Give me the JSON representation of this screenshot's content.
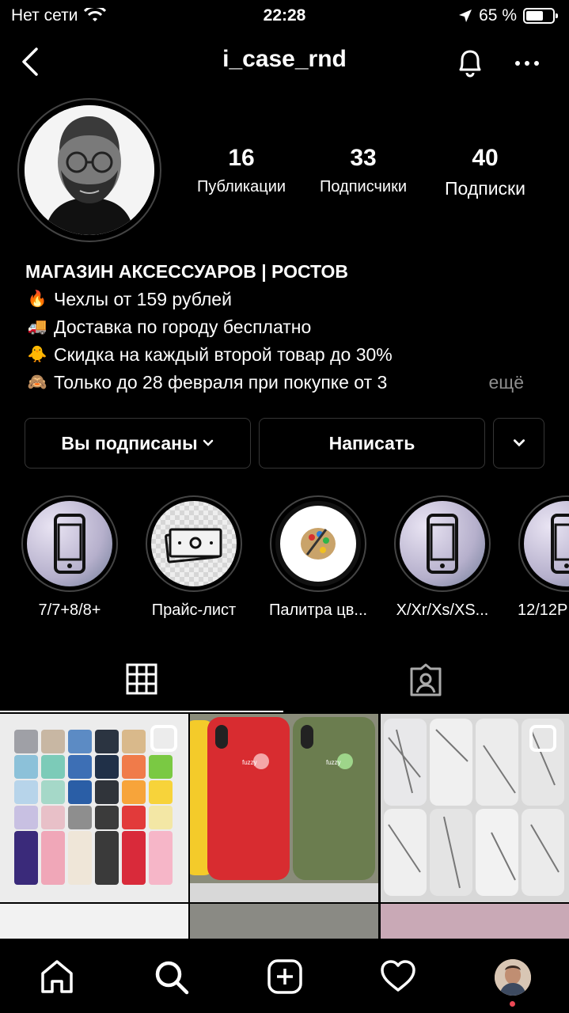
{
  "status_bar": {
    "carrier": "Нет сети",
    "time": "22:28",
    "battery": "65 %",
    "battery_level": 0.65
  },
  "header": {
    "username": "i_case_rnd"
  },
  "stats": [
    {
      "value": "16",
      "label": "Публикации"
    },
    {
      "value": "33",
      "label": "Подписчики"
    },
    {
      "value": "40",
      "label": "Подписки"
    }
  ],
  "bio": {
    "name": "МАГАЗИН АКСЕССУАРОВ | РОСТОВ",
    "lines": [
      {
        "emoji": "🔥",
        "text": "Чехлы от 159 рублей"
      },
      {
        "emoji": "🚚",
        "text": "Доставка по городу бесплатно"
      },
      {
        "emoji": "🐥",
        "text": "Скидка на каждый второй товар до 30%"
      },
      {
        "emoji": "🙈",
        "text": "Только до 28 февраля при покупке от 3"
      }
    ],
    "more": "ещё"
  },
  "buttons": {
    "following": "Вы подписаны",
    "message": "Написать"
  },
  "highlights": [
    {
      "label": "7/7+8/8+",
      "icon": "phone-icon"
    },
    {
      "label": "Прайс-лист",
      "icon": "money-icon"
    },
    {
      "label": "Палитра цв...",
      "icon": "palette-icon"
    },
    {
      "label": "X/Xr/Xs/XS...",
      "icon": "phone-icon"
    },
    {
      "label": "12/12P",
      "icon": "phone-icon"
    }
  ],
  "colors": {
    "background": "#000000",
    "border": "#363636",
    "muted": "#8e8e8e",
    "notification_dot": "#ed4956"
  }
}
